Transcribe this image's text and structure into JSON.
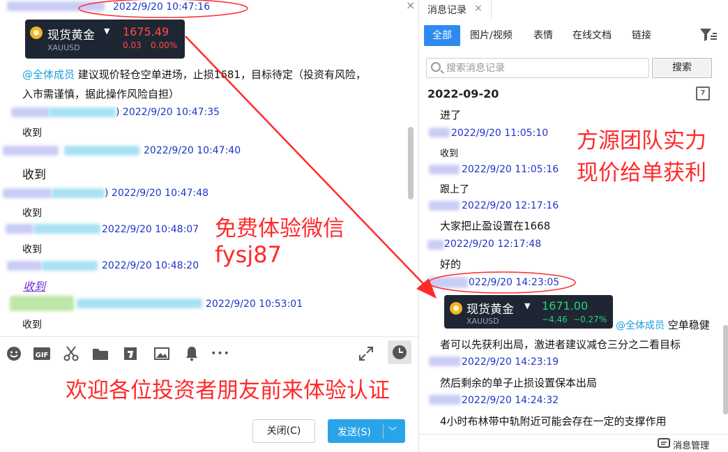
{
  "chat": {
    "close_glyph": "×",
    "messages": [
      {
        "time": "2022/9/20 10:47:16"
      },
      {
        "time": "2022/9/20 10:47:35",
        "text": "收到"
      },
      {
        "time": "2022/9/20 10:47:40",
        "text": "收到"
      },
      {
        "time": "2022/9/20 10:47:48",
        "text": "收到"
      },
      {
        "time": "2022/9/20 10:48:07",
        "text": "收到"
      },
      {
        "time": "2022/9/20 10:48:20",
        "text": "收到"
      },
      {
        "time": "2022/9/20 10:53:01",
        "text": "收到"
      }
    ],
    "gold_card": {
      "name": "现货黄金",
      "symbol": "XAUUSD",
      "price": "1675.49",
      "change": "0.03",
      "change_pct": "0.00%",
      "price_color": "#ff4b4b"
    },
    "announcement": {
      "mention": "@全体成员",
      "line1": "建议现价轻仓空单进场，止损1681，目标待定（投资有风险，",
      "line2": "入市需谨慎，据此操作风险自担）"
    }
  },
  "toolbar": {
    "icons": [
      "emoji-icon",
      "gif-icon",
      "scissors-icon",
      "folder-icon",
      "doc-icon",
      "image-icon",
      "bell-icon",
      "more-icon",
      "expand-icon",
      "history-icon"
    ],
    "gif_label": "GIF",
    "more_label": "•••"
  },
  "buttons": {
    "close_label": "关闭(C)",
    "send_label": "发送(S)",
    "send_arrow": "﹀"
  },
  "history": {
    "tab_title": "消息记录",
    "tab_close": "×",
    "filters": [
      "全部",
      "图片/视频",
      "表情",
      "在线文档",
      "链接"
    ],
    "search_placeholder": "搜索消息记录",
    "search_button": "搜索",
    "date": "2022-09-20",
    "calendar_label": "7",
    "items": [
      {
        "text": "进了"
      },
      {
        "time": "2022/9/20 11:05:10",
        "text": "收到"
      },
      {
        "time": "2022/9/20 11:05:16",
        "text": "跟上了"
      },
      {
        "time": "2022/9/20 12:17:16",
        "text": "大家把止盈设置在1668"
      },
      {
        "time": "2022/9/20 12:17:48",
        "text": "好的"
      },
      {
        "time": "022/9/20 14:23:05"
      },
      {
        "time": "2022/9/20 14:23:19",
        "text": "然后剩余的单子止损设置保本出局"
      },
      {
        "time": "2022/9/20 14:24:32",
        "text": "4小时布林带中轨附近可能会存在一定的支撑作用"
      }
    ],
    "gold_card": {
      "name": "现货黄金",
      "symbol": "XAUUSD",
      "price": "1671.00",
      "change": "−4.46",
      "change_pct": "−0.27%",
      "price_color": "#27d17b"
    },
    "announcement": {
      "mention": "@全体成员",
      "tail": "空单稳健",
      "line2": "者可以先获利出局，激进者建议减仓三分之二看目标"
    },
    "footer_label": "消息管理"
  },
  "annotations": {
    "free_trial": "免费体验微信",
    "wechat_id": "fysj87",
    "team_line1": "方源团队实力",
    "team_line2": "现价给单获利",
    "welcome": "欢迎各位投资者朋友前来体验认证",
    "color": "#ff2a2a"
  }
}
